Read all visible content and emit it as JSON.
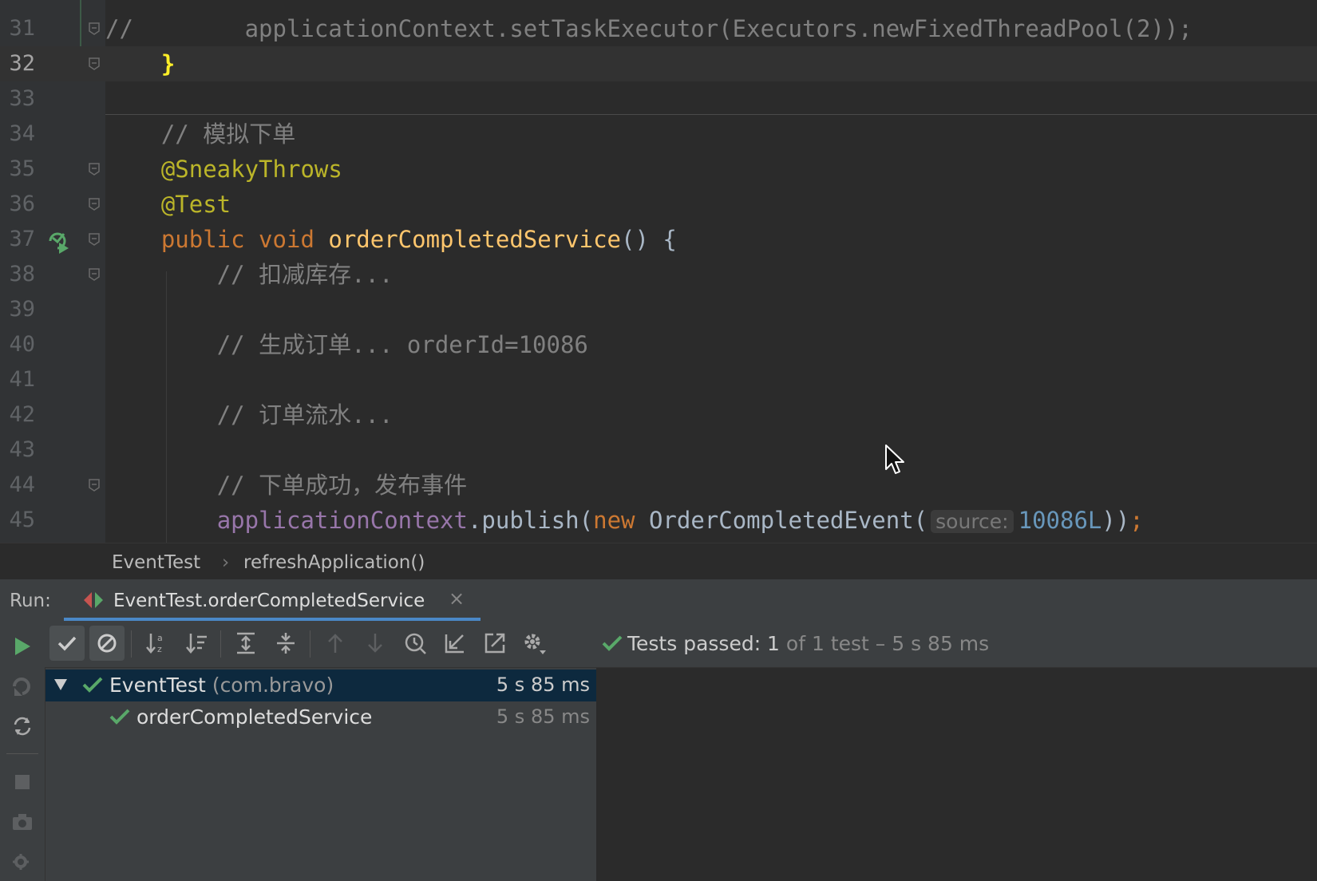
{
  "editor": {
    "lines": [
      {
        "num": "31",
        "parts": [
          {
            "c": "cmt",
            "t": "//        applicationContext.setTaskExecutor(Executors.newFixedThreadPool(2));"
          }
        ]
      },
      {
        "num": "32",
        "parts": [
          {
            "c": "",
            "t": "    "
          },
          {
            "c": "brace",
            "t": "}"
          }
        ]
      },
      {
        "num": "33",
        "parts": []
      },
      {
        "num": "34",
        "parts": [
          {
            "c": "",
            "t": "    "
          },
          {
            "c": "cmt",
            "t": "// 模拟下单"
          }
        ]
      },
      {
        "num": "35",
        "parts": [
          {
            "c": "",
            "t": "    "
          },
          {
            "c": "ann",
            "t": "@SneakyThrows"
          }
        ]
      },
      {
        "num": "36",
        "parts": [
          {
            "c": "",
            "t": "    "
          },
          {
            "c": "ann",
            "t": "@Test"
          }
        ]
      },
      {
        "num": "37",
        "parts": [
          {
            "c": "",
            "t": "    "
          },
          {
            "c": "kw",
            "t": "public void "
          },
          {
            "c": "fn",
            "t": "orderCompletedService"
          },
          {
            "c": "",
            "t": "() {"
          }
        ]
      },
      {
        "num": "38",
        "parts": [
          {
            "c": "",
            "t": "        "
          },
          {
            "c": "cmt",
            "t": "// 扣减库存..."
          }
        ]
      },
      {
        "num": "39",
        "parts": []
      },
      {
        "num": "40",
        "parts": [
          {
            "c": "",
            "t": "        "
          },
          {
            "c": "cmt",
            "t": "// 生成订单... orderId=10086"
          }
        ]
      },
      {
        "num": "41",
        "parts": []
      },
      {
        "num": "42",
        "parts": [
          {
            "c": "",
            "t": "        "
          },
          {
            "c": "cmt",
            "t": "// 订单流水..."
          }
        ]
      },
      {
        "num": "43",
        "parts": []
      },
      {
        "num": "44",
        "parts": [
          {
            "c": "",
            "t": "        "
          },
          {
            "c": "cmt",
            "t": "// 下单成功，发布事件"
          }
        ]
      },
      {
        "num": "45",
        "parts": [
          {
            "c": "",
            "t": "        "
          },
          {
            "c": "fld",
            "t": "applicationContext"
          },
          {
            "c": "",
            "t": ".publish("
          },
          {
            "c": "kw",
            "t": "new "
          },
          {
            "c": "",
            "t": "OrderCompletedEvent("
          },
          {
            "c": "hint",
            "t": "source:"
          },
          {
            "c": "num",
            "t": "10086L"
          },
          {
            "c": "",
            "t": "))"
          },
          {
            "c": "kw",
            "t": ";"
          }
        ]
      }
    ],
    "current_line": "32"
  },
  "breadcrumb": {
    "class": "EventTest",
    "method": "refreshApplication()"
  },
  "run": {
    "label": "Run:",
    "tab_title": "EventTest.orderCompletedService",
    "status_passed": "Tests passed: 1",
    "status_rest": "of 1 test – 5 s 85 ms",
    "tree": [
      {
        "name": "EventTest",
        "pkg": "(com.bravo)",
        "duration": "5 s 85 ms",
        "selected": true
      },
      {
        "name": "orderCompletedService",
        "duration": "5 s 85 ms"
      }
    ]
  },
  "colors": {
    "accent": "#4a88c7",
    "pass": "#59a869",
    "keyword": "#cc7832",
    "function": "#ffc66d",
    "annotation": "#bbb529",
    "comment": "#808080"
  }
}
